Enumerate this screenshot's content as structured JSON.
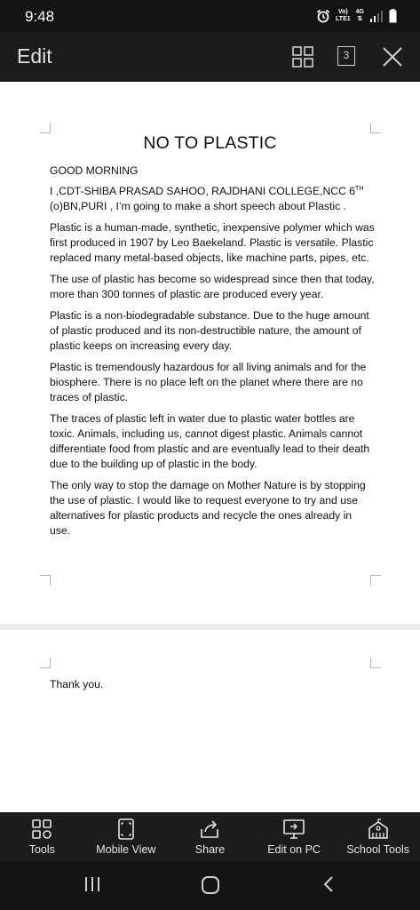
{
  "status_bar": {
    "time": "9:48",
    "volte": "Vo)",
    "lte": "LTE1",
    "network": "4G"
  },
  "top_bar": {
    "edit_label": "Edit",
    "page_count": "3"
  },
  "document": {
    "title": "NO TO PLASTIC",
    "greeting": "GOOD MORNING",
    "intro_line1": "I ,CDT-SHIBA PRASAD SAHOO, RAJDHANI COLLEGE,NCC 6",
    "intro_sup": "TH",
    "intro_line2": "(o)BN,PURI ,  I’m going to make a short speech about Plastic .",
    "paragraphs": [
      "Plastic is a human-made, synthetic, inexpensive polymer which was first produced in 1907 by Leo Baekeland. Plastic is versatile. Plastic replaced many metal-based objects, like machine parts, pipes, etc.",
      "The use of plastic has become so widespread since then that today, more than 300 tonnes of plastic are produced every year.",
      "Plastic is a non-biodegradable substance. Due to the huge amount of plastic produced and its non-destructible nature, the amount of plastic keeps on increasing every day.",
      "Plastic is tremendously hazardous for all living animals and for the biosphere. There is no place left on the planet where there are no traces of plastic.",
      "The traces of plastic left in water due to plastic water bottles are toxic. Animals, including us, cannot digest plastic. Animals cannot differentiate food from plastic and are eventually lead to their death due to the building up of plastic in the body.",
      "The only way to stop the damage on Mother Nature is by stopping the use of plastic. I would like to request everyone to try and use alternatives for plastic products and recycle the ones already in use."
    ],
    "closing": "Thank you."
  },
  "toolbar": {
    "items": [
      {
        "label": "Tools",
        "icon": "tools-grid-icon"
      },
      {
        "label": "Mobile View",
        "icon": "mobile-view-icon"
      },
      {
        "label": "Share",
        "icon": "share-icon"
      },
      {
        "label": "Edit on PC",
        "icon": "monitor-icon"
      },
      {
        "label": "School Tools",
        "icon": "school-icon"
      }
    ]
  }
}
